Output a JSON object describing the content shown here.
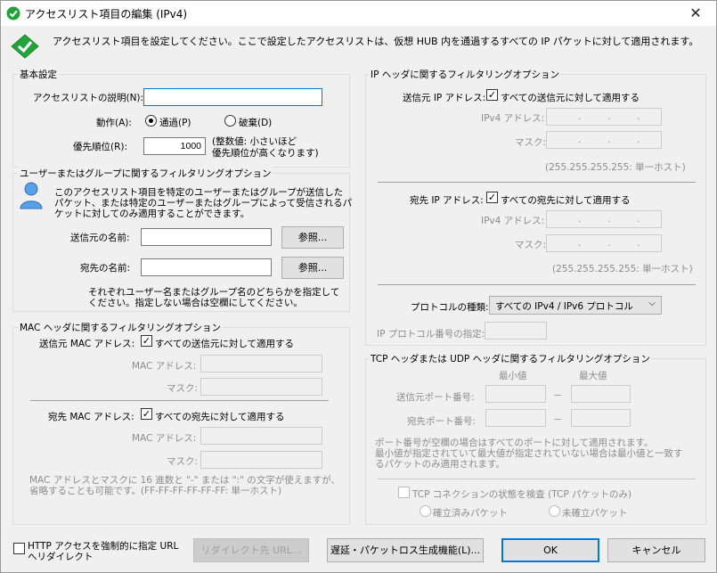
{
  "window": {
    "title": "アクセスリスト項目の編集 (IPv4)",
    "close": "✕"
  },
  "intro": "アクセスリスト項目を設定してください。ここで設定したアクセスリストは、仮想 HUB 内を通過するすべての IP パケットに対して適用されます。",
  "basic": {
    "group": "基本設定",
    "desc_label": "アクセスリストの説明(N):",
    "desc_value": "",
    "action_label": "動作(A):",
    "pass_label": "通過(P)",
    "discard_label": "破棄(D)",
    "priority_label": "優先順位(R):",
    "priority_value": "1000",
    "priority_note1": "(整数値: 小さいほど",
    "priority_note2": "優先順位が高くなります)"
  },
  "user": {
    "group": "ユーザーまたはグループに関するフィルタリングオプション",
    "desc1": "このアクセスリスト項目を特定のユーザーまたはグループが送信した",
    "desc2": "パケット、または特定のユーザーまたはグループによって受信されるパ",
    "desc3": "ケットに対してのみ適用することができます。",
    "src_label": "送信元の名前:",
    "dst_label": "宛先の名前:",
    "browse": "参照...",
    "note1": "それぞれユーザー名またはグループ名のどちらかを指定して",
    "note2": "ください。指定しない場合は空欄にしてください。"
  },
  "mac": {
    "group": "MAC ヘッダに関するフィルタリングオプション",
    "src_label": "送信元 MAC アドレス:",
    "src_check": "すべての送信元に対して適用する",
    "dst_label": "宛先 MAC アドレス:",
    "dst_check": "すべての宛先に対して適用する",
    "addr_label": "MAC アドレス:",
    "mask_label": "マスク:",
    "note1": "MAC アドレスとマスクに 16 進数と \"-\" または \":\" の文字が使えますが、",
    "note2": "省略することも可能です。(FF-FF-FF-FF-FF-FF: 単一ホスト)"
  },
  "ip": {
    "group": "IP ヘッダに関するフィルタリングオプション",
    "src_label": "送信元 IP アドレス:",
    "src_check": "すべての送信元に対して適用する",
    "dst_label": "宛先 IP アドレス:",
    "dst_check": "すべての宛先に対して適用する",
    "ipv4_label": "IPv4 アドレス:",
    "mask_label": "マスク:",
    "hint": "(255.255.255.255: 単一ホスト)",
    "protocol_label": "プロトコルの種類:",
    "protocol_value": "すべての IPv4 / IPv6 プロトコル",
    "protocol_num_label": "IP プロトコル番号の指定:"
  },
  "tcp": {
    "group": "TCP ヘッダまたは UDP ヘッダに関するフィルタリングオプション",
    "min": "最小値",
    "max": "最大値",
    "src_port": "送信元ポート番号:",
    "dst_port": "宛先ポート番号:",
    "dash": "－",
    "note1": "ポート番号が空欄の場合はすべてのポートに対して適用されます。",
    "note2": "最小値が指定されていて最大値が指定されていない場合は最小値と一致す",
    "note3": "るパケットのみ適用されます。",
    "state_check": "TCP コネクションの状態を検査 (TCP パケットのみ)",
    "established": "確立済みパケット",
    "not_established": "未確立パケット"
  },
  "footer": {
    "http_line1": "HTTP アクセスを強制的に指定 URL",
    "http_line2": "へリダイレクト",
    "redirect_btn": "リダイレクト先 URL...",
    "delay_btn": "遅延・パケットロス生成機能(L)...",
    "ok": "OK",
    "cancel": "キャンセル"
  }
}
